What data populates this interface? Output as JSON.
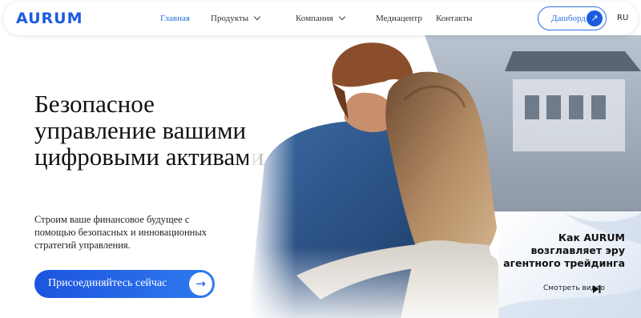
{
  "header": {
    "logo": "AURUM",
    "nav": [
      {
        "label": "Главная",
        "active": true
      },
      {
        "label": "Продукты",
        "dropdown": true
      },
      {
        "label": "Компания",
        "dropdown": true
      },
      {
        "label": "Медиацентр"
      },
      {
        "label": "Контакты"
      }
    ],
    "dashboard_label": "Дашборд",
    "language": "RU"
  },
  "hero": {
    "headline": "Безопасное управление вашими цифровыми активами",
    "subtext": "Строим ваше финансовое будущее с помощью безопасных и инновационных стратегий управления.",
    "cta_label": "Присоединяйтесь сейчас"
  },
  "video_card": {
    "title": "Как AURUM возглавляет эру агентного трейдинга",
    "link_label": "Смотреть видео"
  },
  "colors": {
    "accent": "#1d5be0",
    "active_link": "#2a6fe0"
  },
  "icons": [
    "chevron-down-icon",
    "arrow-up-right-icon",
    "arrow-right-icon",
    "play-icon"
  ]
}
